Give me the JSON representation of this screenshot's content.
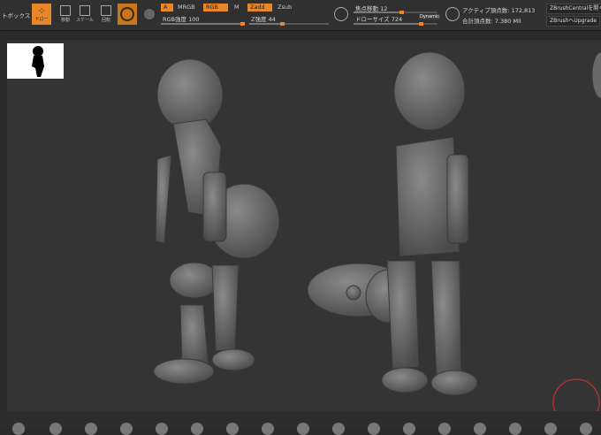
{
  "toolbar": {
    "toolbox_label": "トボックス",
    "draw_label": "ドロー",
    "move_label": "移動",
    "scale_label": "スケール",
    "rotate_label": "回転",
    "a_label": "A",
    "mrgb_label": "MRGB",
    "rgb_label": "RGB",
    "m_label": "M",
    "zadd_label": "Zadd",
    "zsub_label": "Zsub",
    "rgb_intensity_label": "RGB強度",
    "rgb_intensity_value": "100",
    "rgb_intensity": 1.0,
    "z_intensity_label": "Z強度",
    "z_intensity_value": "44",
    "z_intensity": 0.44,
    "focal_shift_label": "焦点移動",
    "focal_shift_value": "12",
    "draw_size_label": "ドローサイズ",
    "draw_size_value": "724",
    "dynamic_label": "Dynamic",
    "active_points_label": "アクティブ頂点数:",
    "active_points_value": "172,813",
    "total_points_label": "合計頂点数:",
    "total_points_value": "7.380 Mil",
    "zbrushcentral_label": "ZBrushCentralを開く",
    "upgrade_label": "ZBrushへUpgrade"
  },
  "colors": {
    "accent": "#e8872a",
    "toolbar_bg": "#303030",
    "canvas_bg": "#343434"
  }
}
